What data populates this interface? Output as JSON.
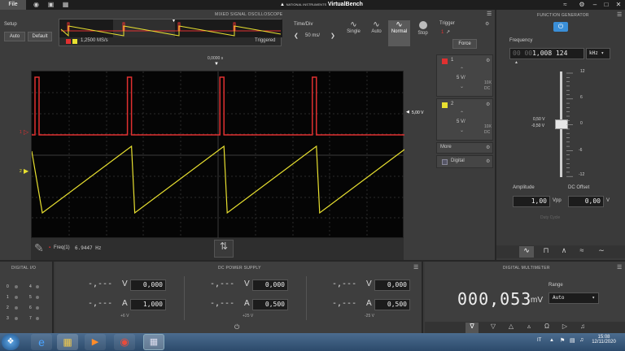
{
  "titlebar": {
    "file": "File",
    "brand_small": "NATIONAL INSTRUMENTS",
    "brand": "VirtualBench"
  },
  "oscilloscope": {
    "title": "MIXED SIGNAL OSCILLOSCOPE",
    "setup_label": "Setup",
    "auto_button": "Auto",
    "default_button": "Default",
    "sample_rate": "1,2500 MS/s",
    "triggered": "Triggered",
    "time_div_label": "Time/Div",
    "time_div_value": "50 ms/",
    "modes": [
      "Single",
      "Auto",
      "Normal",
      "Stop"
    ],
    "active_mode": "Normal",
    "trigger_time": "0,0000 s",
    "trigger_level": "5,00 V",
    "ch1_marker": "1",
    "ch2_marker": "2",
    "measurement": "Freq(1)",
    "measurement_value": "6.9447 Hz",
    "trigger": {
      "label": "Trigger",
      "source": "1",
      "force": "Force"
    },
    "channel1": {
      "name": "1",
      "scale": "5 V/",
      "probe": "10X",
      "coupling": "DC",
      "color": "#e03030"
    },
    "channel2": {
      "name": "2",
      "scale": "5 V/",
      "probe": "10X",
      "coupling": "DC",
      "color": "#e8e030"
    },
    "more": "More",
    "digital": "Digital"
  },
  "function_generator": {
    "title": "FUNCTION GENERATOR",
    "frequency_label": "Frequency",
    "frequency_dim": "00 00",
    "frequency_value": "1,008 124",
    "frequency_unit": "kHz",
    "scale_ticks": [
      "12",
      "6",
      "0",
      "-6",
      "-12"
    ],
    "level_high": "0,50 V",
    "level_low": "-0,50 V",
    "amplitude_label": "Amplitude",
    "amplitude_value": "1,00",
    "amplitude_unit": "Vpp",
    "dc_offset_label": "DC Offset",
    "dc_offset_value": "0,00",
    "dc_offset_unit": "V",
    "duty_cycle_label": "Duty Cycle"
  },
  "digital_io": {
    "title": "DIGITAL I/O",
    "pins_left": [
      "0",
      "1",
      "2",
      "3"
    ],
    "pins_right": [
      "4",
      "5",
      "6",
      "7"
    ]
  },
  "dc_power": {
    "title": "DC POWER SUPPLY",
    "channels": [
      {
        "measured_v": "-,---",
        "v_unit": "V",
        "set_v": "0,000",
        "measured_a": "-,---",
        "a_unit": "A",
        "set_a": "1,000",
        "label": "+6 V"
      },
      {
        "measured_v": "-,---",
        "v_unit": "V",
        "set_v": "0,000",
        "measured_a": "-,---",
        "a_unit": "A",
        "set_a": "0,500",
        "label": "+25 V"
      },
      {
        "measured_v": "-,---",
        "v_unit": "V",
        "set_v": "0,000",
        "measured_a": "-,---",
        "a_unit": "A",
        "set_a": "0,500",
        "label": "-25 V"
      }
    ]
  },
  "multimeter": {
    "title": "DIGITAL MULTIMETER",
    "reading": "000,053",
    "unit": "mV",
    "range_label": "Range",
    "range_value": "Auto"
  },
  "taskbar": {
    "language": "IT",
    "time": "15:08",
    "date": "12/11/2020"
  }
}
